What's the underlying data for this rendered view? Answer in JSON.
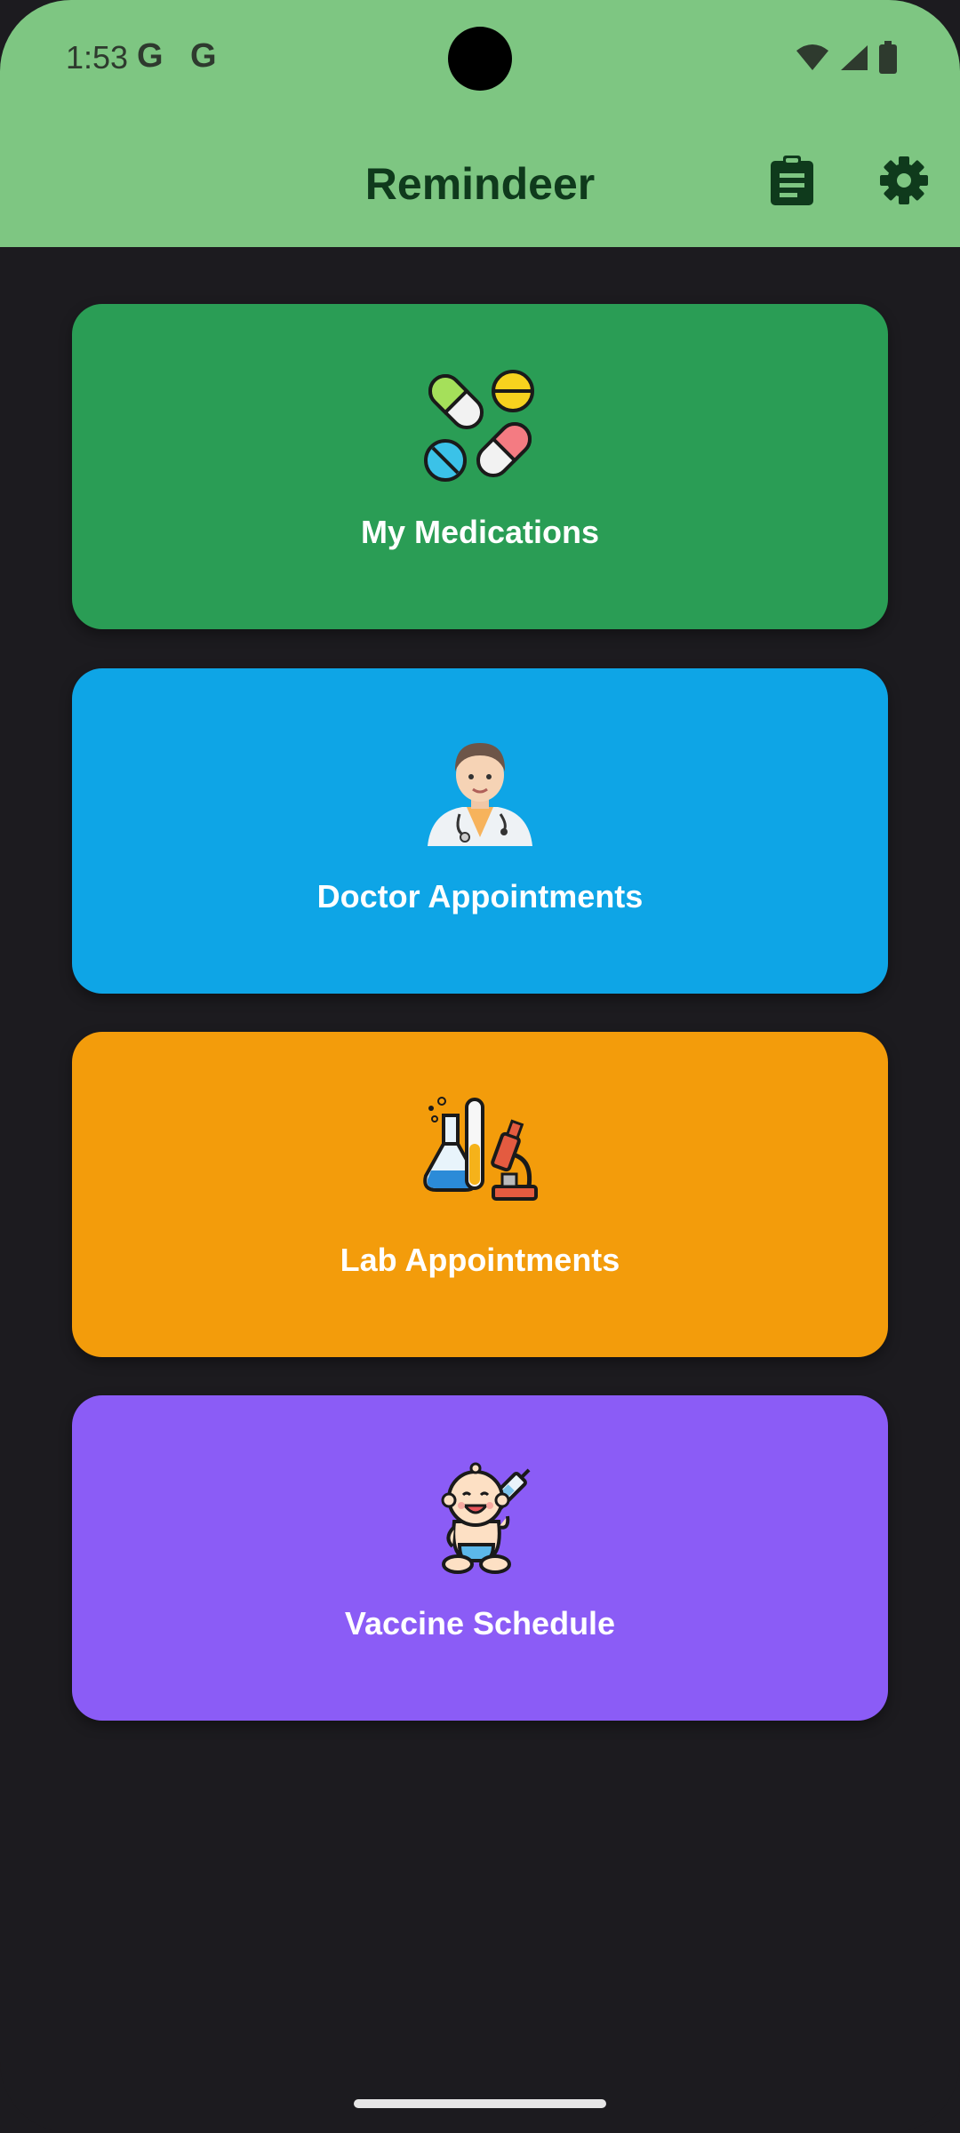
{
  "status_bar": {
    "time": "1:53",
    "notification_icons": [
      "G",
      "G"
    ],
    "system_icons": [
      "wifi-icon",
      "signal-icon",
      "battery-icon"
    ]
  },
  "app_bar": {
    "title": "Remindeer",
    "actions": [
      "clipboard-icon",
      "gear-icon"
    ]
  },
  "cards": [
    {
      "label": "My Medications",
      "icon": "pills-icon",
      "color": "#2a9d55"
    },
    {
      "label": "Doctor Appointments",
      "icon": "doctor-icon",
      "color": "#0ea5e6"
    },
    {
      "label": "Lab Appointments",
      "icon": "lab-icon",
      "color": "#f39c0b"
    },
    {
      "label": "Vaccine Schedule",
      "icon": "baby-vaccine-icon",
      "color": "#8b5cf6"
    }
  ],
  "colors": {
    "header": "#7ec682",
    "background": "#1c1b1f",
    "title_text": "#0f3a1c"
  }
}
